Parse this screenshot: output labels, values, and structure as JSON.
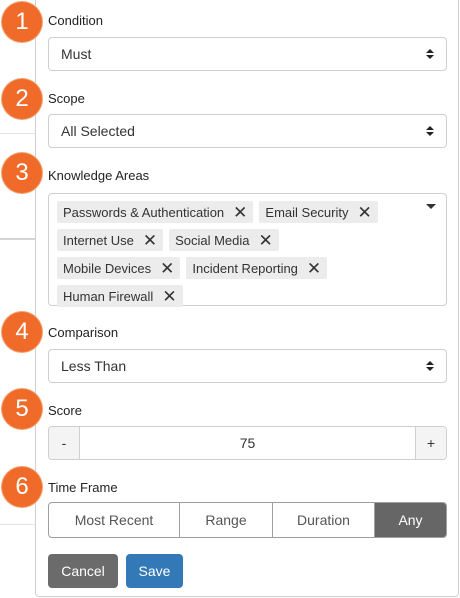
{
  "steps": [
    {
      "number": "1",
      "label": "Condition"
    },
    {
      "number": "2",
      "label": "Scope"
    },
    {
      "number": "3",
      "label": "Knowledge Areas"
    },
    {
      "number": "4",
      "label": "Comparison"
    },
    {
      "number": "5",
      "label": "Score"
    },
    {
      "number": "6",
      "label": "Time Frame"
    }
  ],
  "condition": {
    "value": "Must"
  },
  "scope": {
    "value": "All Selected"
  },
  "knowledge_areas": {
    "tags": [
      "Passwords & Authentication",
      "Email Security",
      "Internet Use",
      "Social Media",
      "Mobile Devices",
      "Incident Reporting",
      "Human Firewall"
    ],
    "remove_glyph": "✕"
  },
  "comparison": {
    "value": "Less Than"
  },
  "score": {
    "value": "75",
    "minus": "-",
    "plus": "+"
  },
  "time_frame": {
    "options": [
      "Most Recent",
      "Range",
      "Duration",
      "Any"
    ],
    "selected": "Any"
  },
  "actions": {
    "cancel": "Cancel",
    "save": "Save"
  },
  "colors": {
    "badge": "#f06b2a",
    "save": "#3379b7",
    "cancel": "#6b6b6b",
    "active_segment": "#666666"
  }
}
